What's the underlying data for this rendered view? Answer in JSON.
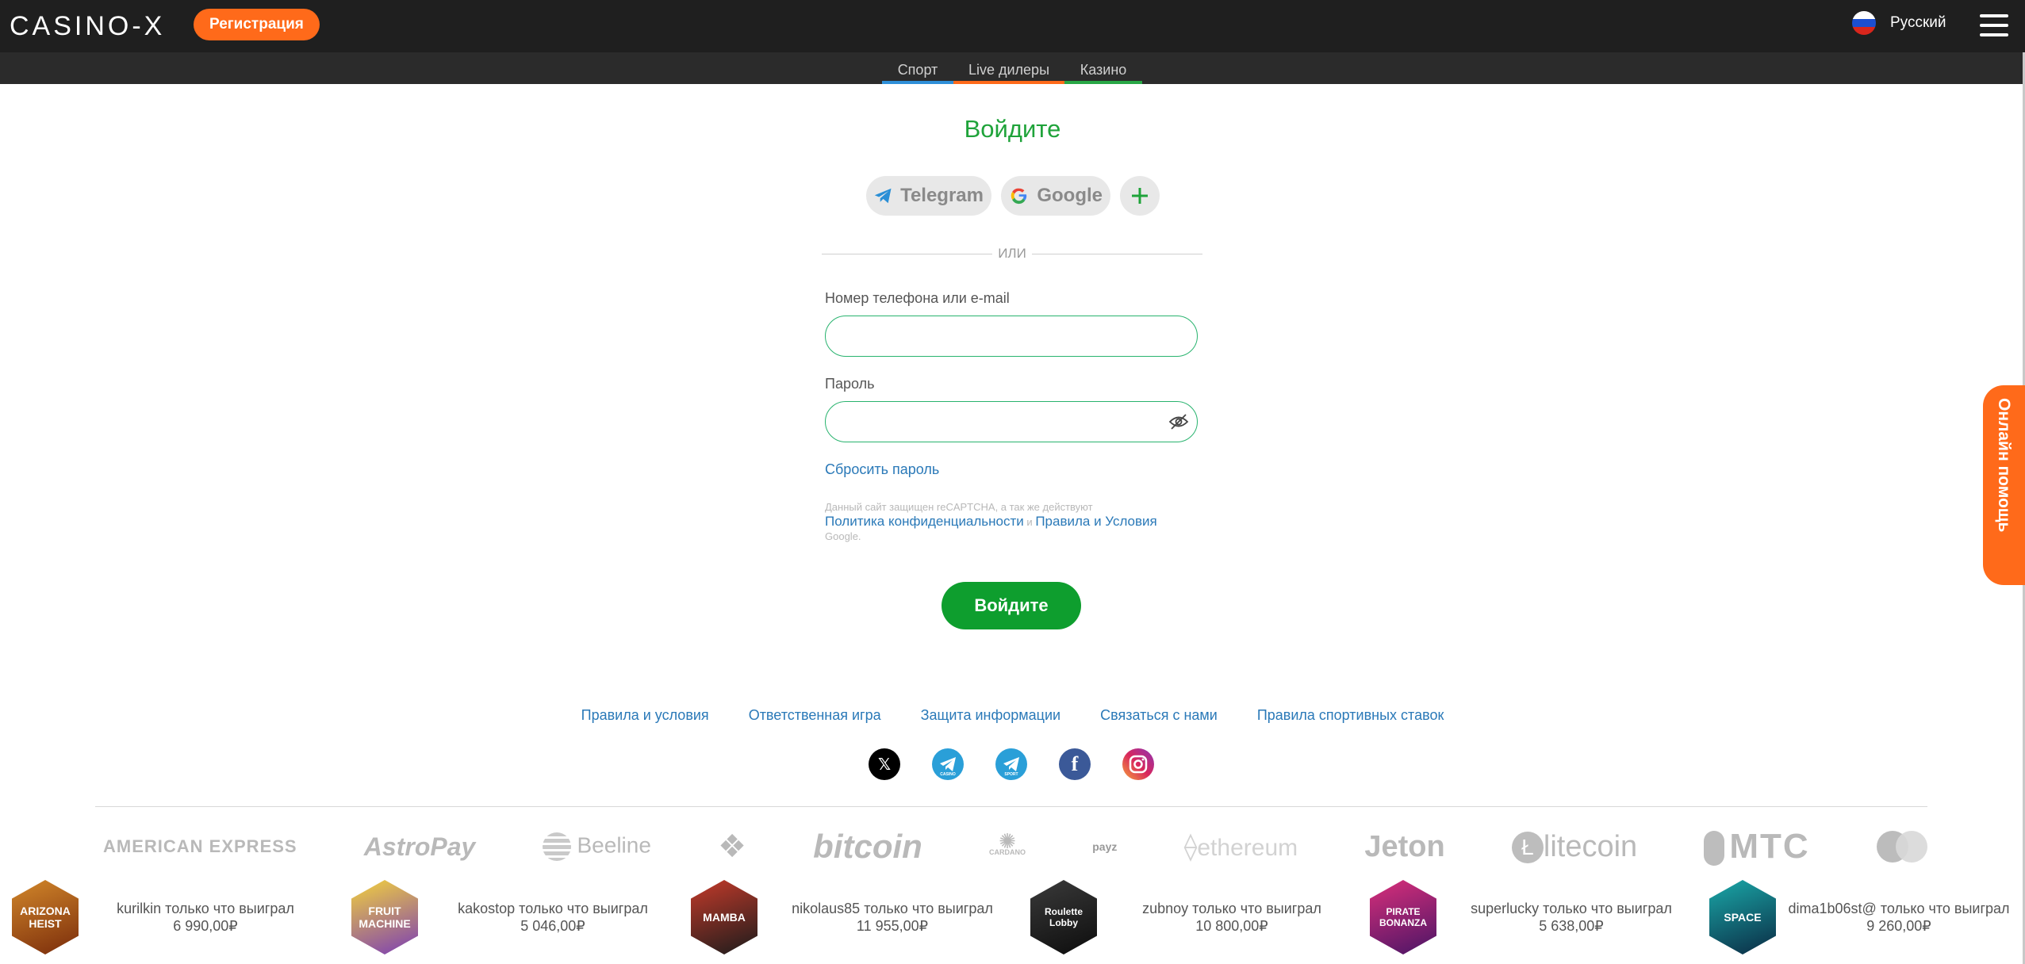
{
  "header": {
    "logo": "CASINO-X",
    "register_label": "Регистрация",
    "language": "Русский"
  },
  "subnav": {
    "tabs": [
      {
        "label": "Спорт",
        "color": "#2e8fd8"
      },
      {
        "label": "Live дилеры",
        "color": "#ff6a1a"
      },
      {
        "label": "Казино",
        "color": "#28a745"
      }
    ]
  },
  "login": {
    "title": "Войдите",
    "telegram_label": "Telegram",
    "google_label": "Google",
    "or_label": "ИЛИ",
    "login_label": "Номер телефона или e-mail",
    "login_value": "",
    "password_label": "Пароль",
    "password_value": "",
    "reset_label": "Сбросить пароль",
    "captcha_text": "Данный сайт защищен reCAPTCHA, а так же действуют",
    "privacy_label": "Политика конфиденциальности",
    "and_label": "и",
    "terms_label": "Правила и Условия",
    "google_suffix": "Google.",
    "submit_label": "Войдите"
  },
  "footer": {
    "links": [
      "Правила и условия",
      "Ответственная игра",
      "Защита информации",
      "Связаться с нами",
      "Правила спортивных ставок"
    ],
    "socials": [
      "x-icon",
      "telegram-casino-icon",
      "telegram-sport-icon",
      "facebook-icon",
      "instagram-icon"
    ],
    "social_labels": {
      "telegram_casino": "CASINO",
      "telegram_sport": "SPORT"
    }
  },
  "payments": [
    "AMERICAN EXPRESS",
    "AstroPay",
    "Beeline",
    "binance",
    "bitcoin",
    "CARDANO",
    "payz",
    "ethereum",
    "Jeton",
    "litecoin",
    "МТС",
    "mastercard"
  ],
  "winners": [
    {
      "game": "ARIZONA HEIST",
      "user": "kurilkin",
      "action": "только что выиграл",
      "amount": "6 990,00₽"
    },
    {
      "game": "FRUIT MACHINE",
      "user": "kakostop",
      "action": "только что выиграл",
      "amount": "5 046,00₽"
    },
    {
      "game": "MAMBA",
      "user": "nikolaus85",
      "action": "только что выиграл",
      "amount": "11 955,00₽"
    },
    {
      "game": "Roulette Lobby",
      "user": "zubnoy",
      "action": "только что выиграл",
      "amount": "10 800,00₽"
    },
    {
      "game": "PIRATE BONANZA",
      "user": "superlucky",
      "action": "только что выиграл",
      "amount": "5 638,00₽"
    },
    {
      "game": "SPACE",
      "user": "dima1b06st@",
      "action": "только что выиграл",
      "amount": "9 260,00₽"
    }
  ],
  "help_label": "Онлайн помощь"
}
